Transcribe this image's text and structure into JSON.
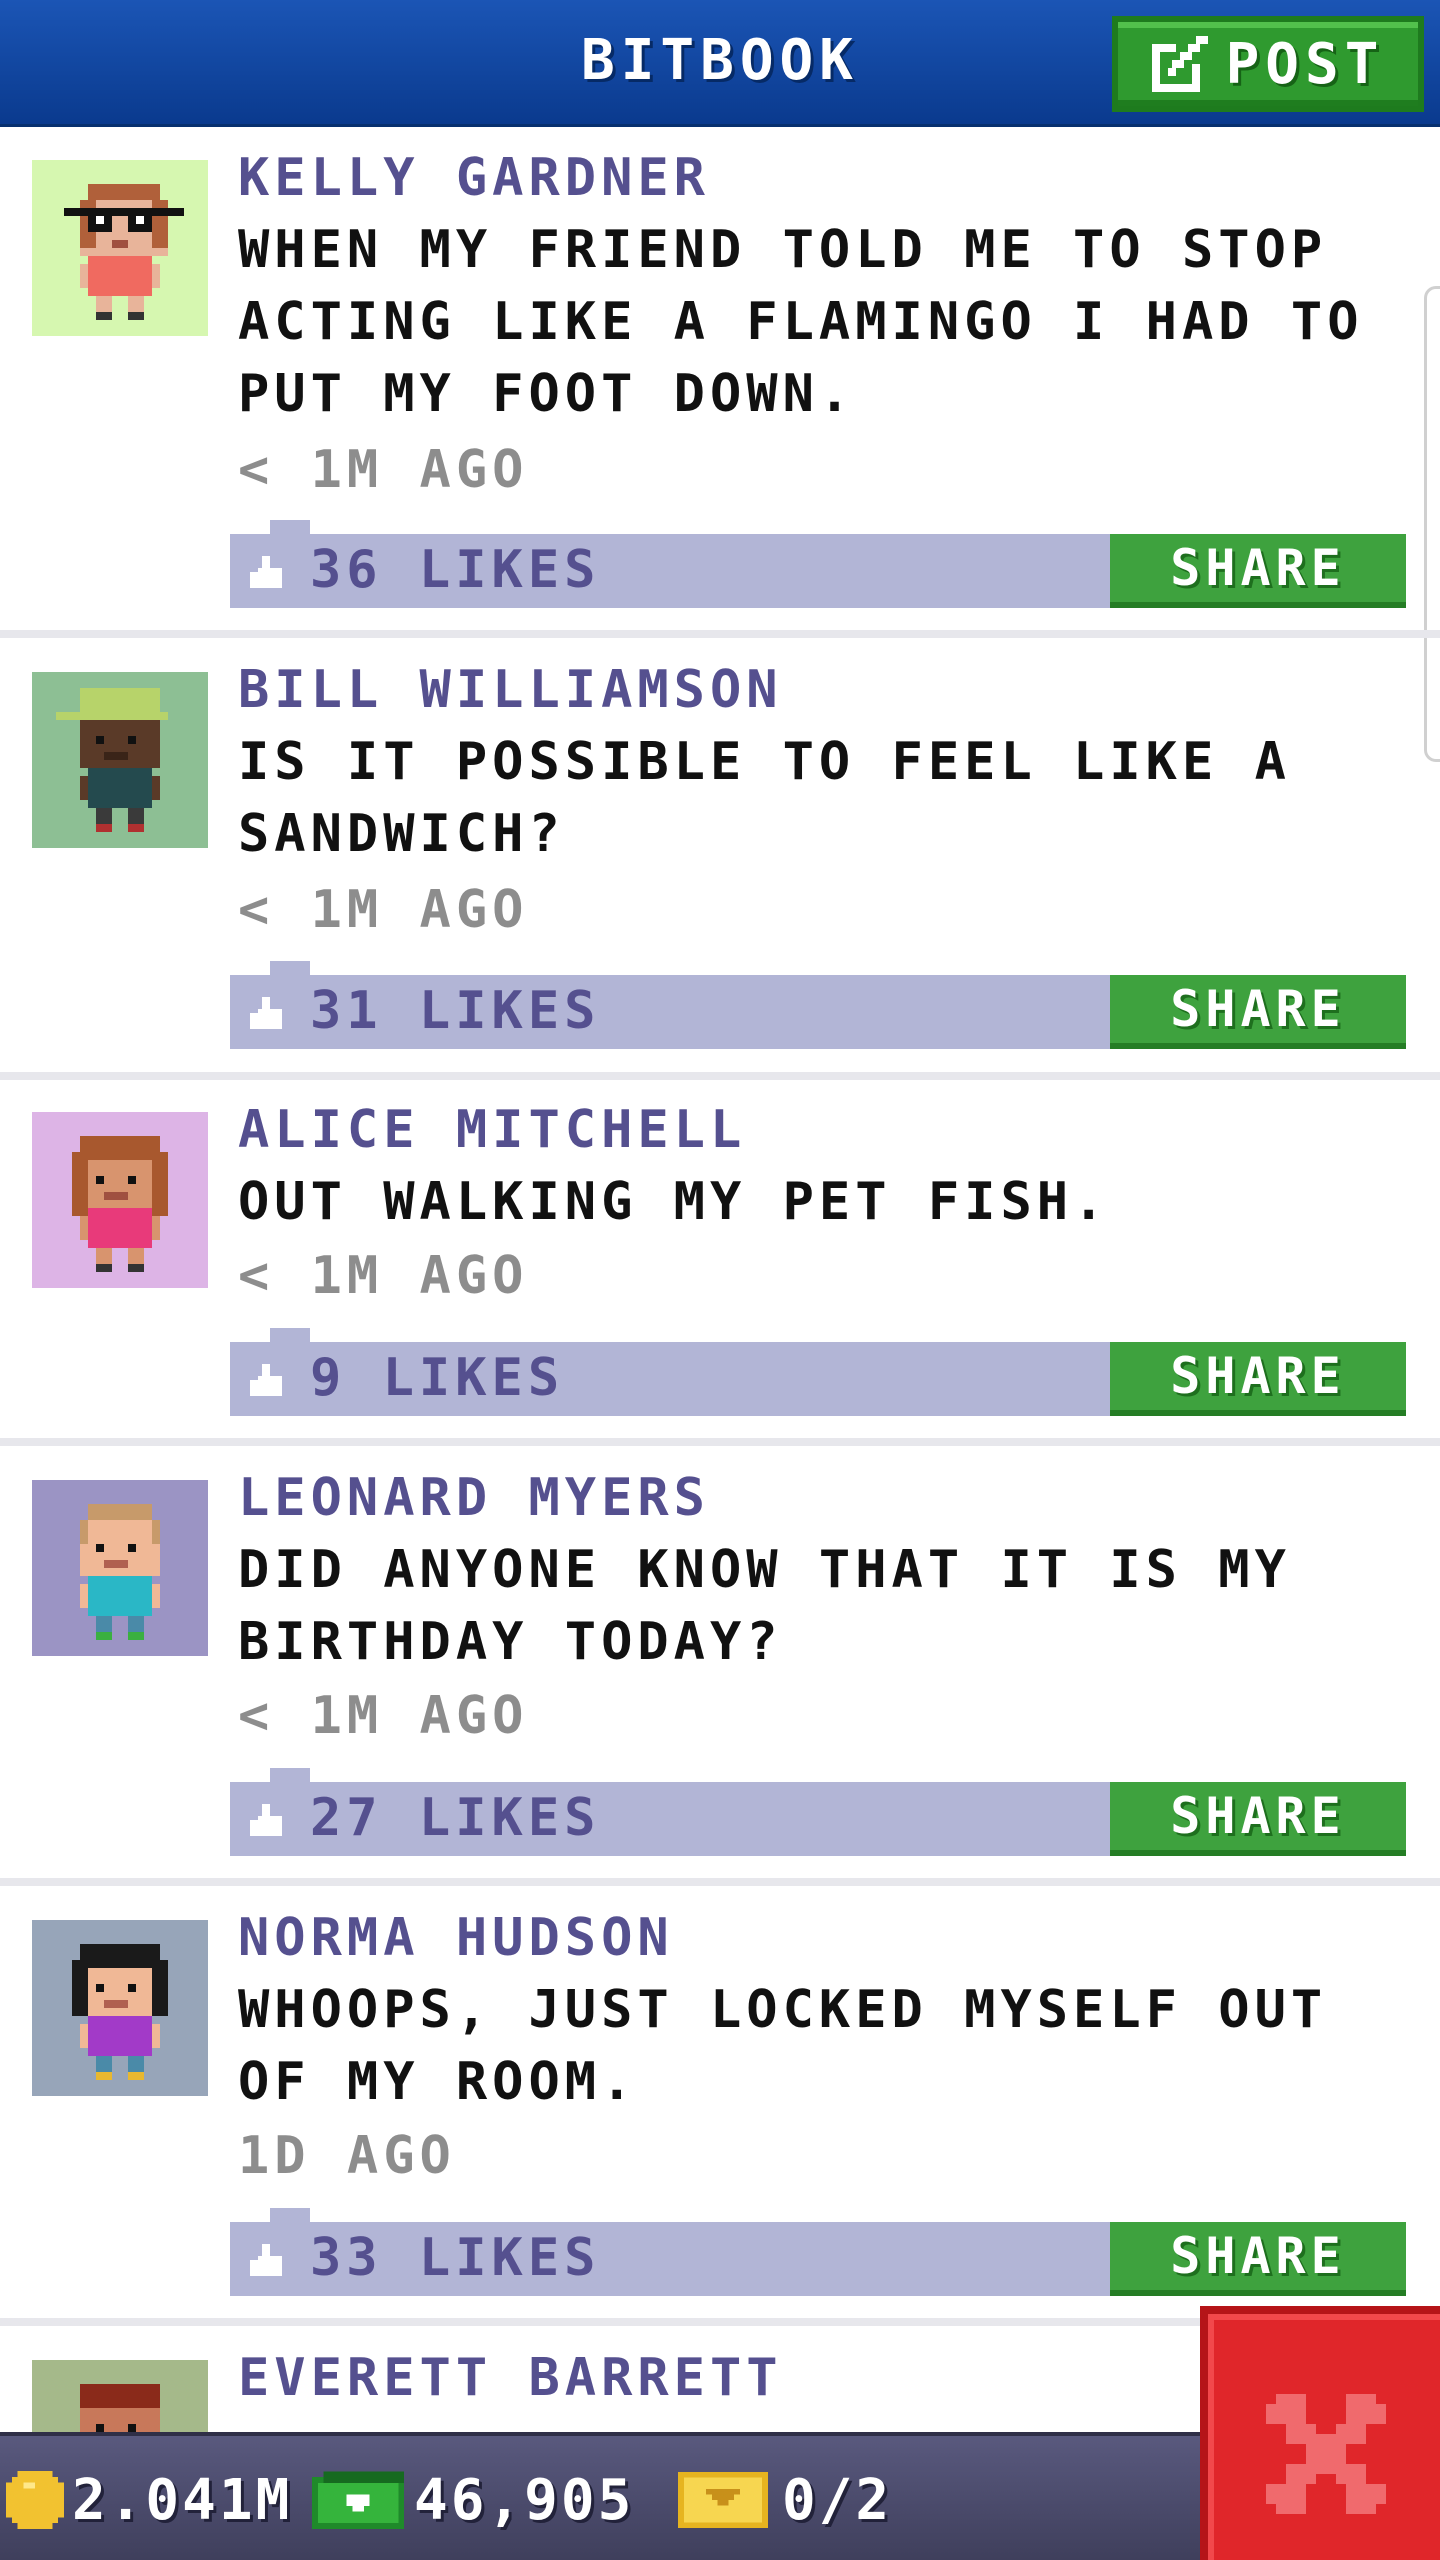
{
  "header": {
    "title": "BITBOOK",
    "post_label": "POST"
  },
  "posts": [
    {
      "author": "KELLY GARDNER",
      "message": "WHEN MY FRIEND TOLD ME TO STOP ACTING LIKE A FLAMINGO I HAD TO PUT MY FOOT DOWN.",
      "time": "< 1M AGO",
      "likes": "36 LIKES",
      "share_label": "SHARE",
      "avatar_bg": "#d6f7b0"
    },
    {
      "author": "BILL WILLIAMSON",
      "message": "IS IT POSSIBLE TO FEEL LIKE A SANDWICH?",
      "time": "< 1M AGO",
      "likes": "31 LIKES",
      "share_label": "SHARE",
      "avatar_bg": "#8dbf94"
    },
    {
      "author": "ALICE MITCHELL",
      "message": "OUT WALKING MY PET FISH.",
      "time": "< 1M AGO",
      "likes": "9 LIKES",
      "share_label": "SHARE",
      "avatar_bg": "#ddb4e6"
    },
    {
      "author": "LEONARD MYERS",
      "message": "DID ANYONE KNOW THAT IT IS MY BIRTHDAY TODAY?",
      "time": "< 1M AGO",
      "likes": "27 LIKES",
      "share_label": "SHARE",
      "avatar_bg": "#9b94c4"
    },
    {
      "author": "NORMA HUDSON",
      "message": "WHOOPS, JUST LOCKED MYSELF OUT OF MY ROOM.",
      "time": "1D AGO",
      "likes": "33 LIKES",
      "share_label": "SHARE",
      "avatar_bg": "#97a5b9"
    },
    {
      "author": "EVERETT BARRETT",
      "avatar_bg": "#a5b98a"
    }
  ],
  "status": {
    "coins": "2.041M",
    "bux": "46,905",
    "tickets": "0/2"
  },
  "colors": {
    "header": "#1b55b5",
    "post_button": "#2f9a2f",
    "share_button": "#3ea23e",
    "like_bar": "#b2b5d6",
    "author": "#55508f",
    "close_button": "#e0262a"
  },
  "icons": {
    "post": "edit-icon",
    "like": "thumbs-up-icon",
    "coin": "coin-icon",
    "bux": "bux-icon",
    "ticket": "ticket-icon",
    "close": "close-icon"
  }
}
